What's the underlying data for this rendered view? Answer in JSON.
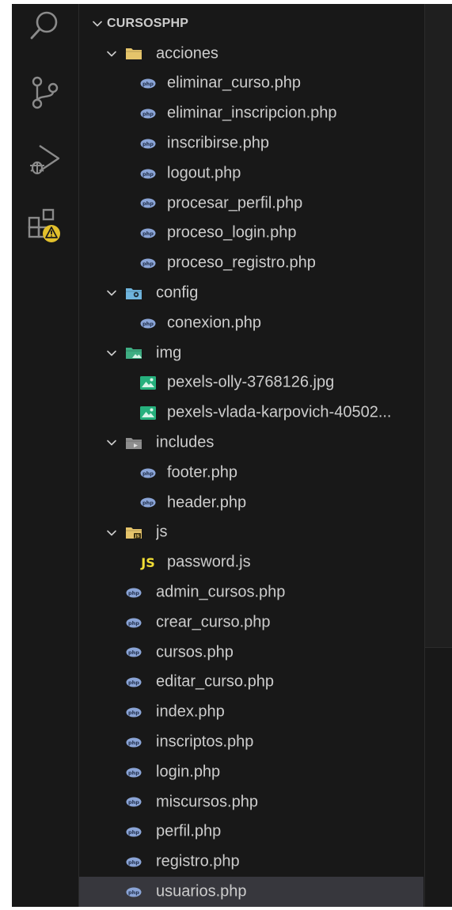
{
  "activity_bar": {
    "items": [
      {
        "name": "search",
        "icon": "search-icon"
      },
      {
        "name": "source-control",
        "icon": "source-control-icon"
      },
      {
        "name": "run-debug",
        "icon": "run-debug-icon"
      },
      {
        "name": "extensions",
        "icon": "extensions-warning-icon"
      }
    ],
    "warning_color": "#e2c02c"
  },
  "explorer": {
    "root": "CURSOSPHP",
    "tree": [
      {
        "label": "CURSOSPHP",
        "type": "root",
        "depth": 0,
        "expanded": true
      },
      {
        "label": "acciones",
        "type": "folder",
        "folder_icon": "folder-open-yellow-icon",
        "depth": 1,
        "expanded": true
      },
      {
        "label": "eliminar_curso.php",
        "type": "php",
        "depth": 2
      },
      {
        "label": "eliminar_inscripcion.php",
        "type": "php",
        "depth": 2
      },
      {
        "label": "inscribirse.php",
        "type": "php",
        "depth": 2
      },
      {
        "label": "logout.php",
        "type": "php",
        "depth": 2
      },
      {
        "label": "procesar_perfil.php",
        "type": "php",
        "depth": 2
      },
      {
        "label": "proceso_login.php",
        "type": "php",
        "depth": 2
      },
      {
        "label": "proceso_registro.php",
        "type": "php",
        "depth": 2
      },
      {
        "label": "config",
        "type": "folder",
        "folder_icon": "folder-config-blue-icon",
        "depth": 1,
        "expanded": true
      },
      {
        "label": "conexion.php",
        "type": "php",
        "depth": 2
      },
      {
        "label": "img",
        "type": "folder",
        "folder_icon": "folder-images-green-icon",
        "depth": 1,
        "expanded": true
      },
      {
        "label": "pexels-olly-3768126.jpg",
        "type": "image",
        "depth": 2
      },
      {
        "label": "pexels-vlada-karpovich-40502...",
        "type": "image",
        "depth": 2
      },
      {
        "label": "includes",
        "type": "folder",
        "folder_icon": "folder-includes-gray-icon",
        "depth": 1,
        "expanded": true
      },
      {
        "label": "footer.php",
        "type": "php",
        "depth": 2
      },
      {
        "label": "header.php",
        "type": "php",
        "depth": 2
      },
      {
        "label": "js",
        "type": "folder",
        "folder_icon": "folder-js-yellow-icon",
        "depth": 1,
        "expanded": true
      },
      {
        "label": "password.js",
        "type": "js",
        "icon_text": "JS",
        "depth": 2
      },
      {
        "label": "admin_cursos.php",
        "type": "php",
        "depth": 1
      },
      {
        "label": "crear_curso.php",
        "type": "php",
        "depth": 1
      },
      {
        "label": "cursos.php",
        "type": "php",
        "depth": 1
      },
      {
        "label": "editar_curso.php",
        "type": "php",
        "depth": 1
      },
      {
        "label": "index.php",
        "type": "php",
        "depth": 1
      },
      {
        "label": "inscriptos.php",
        "type": "php",
        "depth": 1
      },
      {
        "label": "login.php",
        "type": "php",
        "depth": 1
      },
      {
        "label": "miscursos.php",
        "type": "php",
        "depth": 1
      },
      {
        "label": "perfil.php",
        "type": "php",
        "depth": 1
      },
      {
        "label": "registro.php",
        "type": "php",
        "depth": 1
      },
      {
        "label": "usuarios.php",
        "type": "php",
        "depth": 1,
        "selected": true
      }
    ]
  },
  "colors": {
    "background": "#181818",
    "text": "#cccccc",
    "selected_row": "#37373d",
    "php_icon": "#8aa4d6",
    "image_icon": "#26b07d",
    "js_icon": "#f1dd35",
    "folder_yellow": "#e5c46b",
    "folder_blue": "#6fb4dd",
    "folder_green": "#3fae83",
    "folder_gray": "#8e8e8e"
  }
}
